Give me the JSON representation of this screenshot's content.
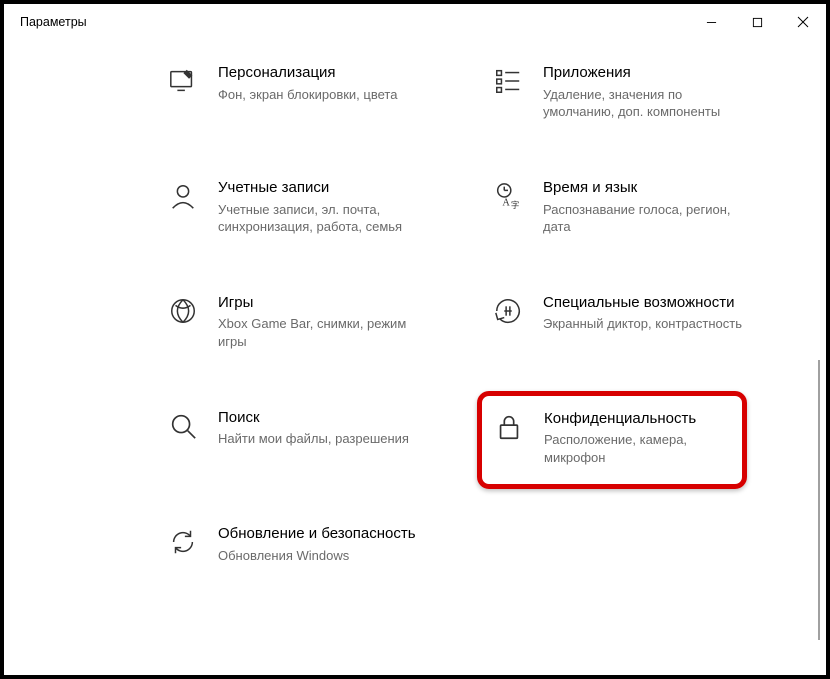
{
  "window": {
    "title": "Параметры"
  },
  "tiles": {
    "personalization": {
      "title": "Персонализация",
      "desc": "Фон, экран блокировки, цвета"
    },
    "apps": {
      "title": "Приложения",
      "desc": "Удаление, значения по умолчанию, доп. компоненты"
    },
    "accounts": {
      "title": "Учетные записи",
      "desc": "Учетные записи, эл. почта, синхронизация, работа, семья"
    },
    "timelang": {
      "title": "Время и язык",
      "desc": "Распознавание голоса, регион, дата"
    },
    "gaming": {
      "title": "Игры",
      "desc": "Xbox Game Bar, снимки, режим игры"
    },
    "ease": {
      "title": "Специальные возможности",
      "desc": "Экранный диктор, контрастность"
    },
    "search": {
      "title": "Поиск",
      "desc": "Найти мои файлы, разрешения"
    },
    "privacy": {
      "title": "Конфиденциальность",
      "desc": "Расположение, камера, микрофон"
    },
    "update": {
      "title": "Обновление и безопасность",
      "desc": "Обновления Windows"
    }
  }
}
